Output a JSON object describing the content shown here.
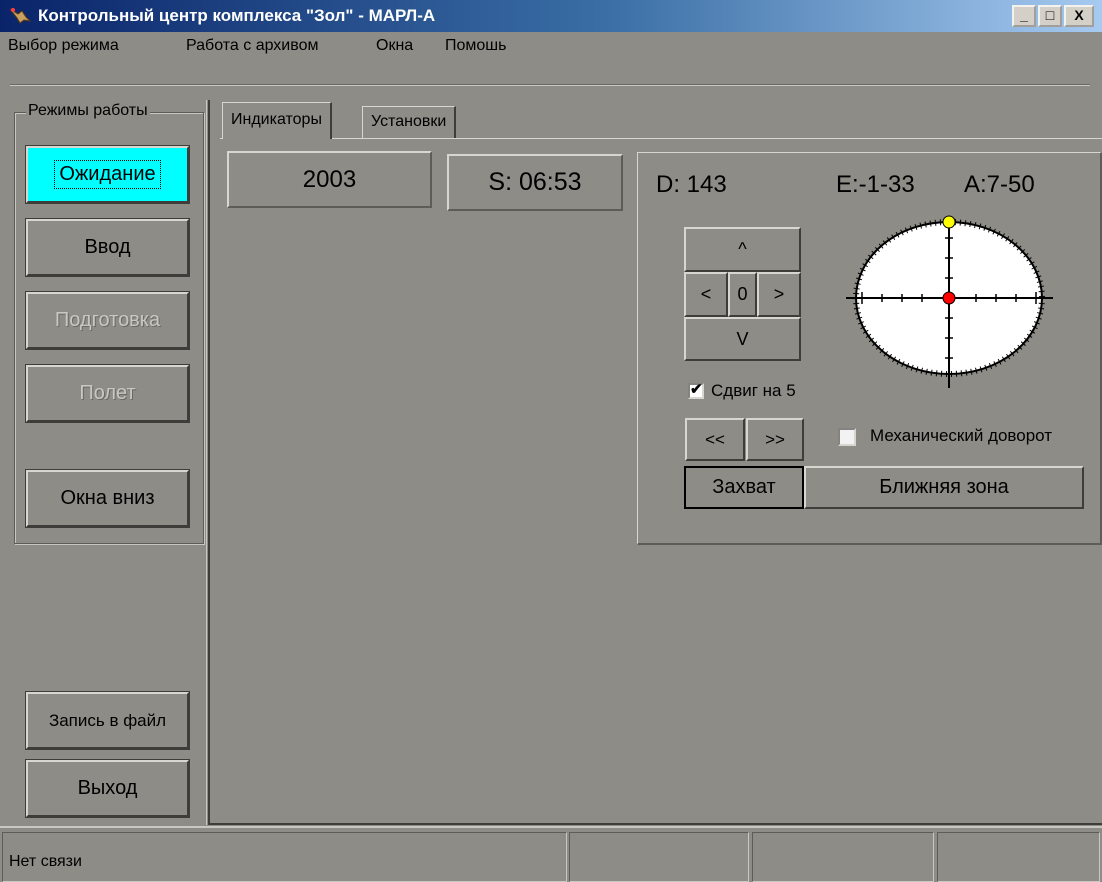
{
  "window": {
    "title": "Контрольный центр комплекса \"Зол\" - МАРЛ-А",
    "min": "_",
    "max": "□",
    "close": "X"
  },
  "menu": [
    "Выбор режима",
    "Работа с архивом",
    "Окна",
    "Помошь"
  ],
  "modes": {
    "legend": "Режимы работы",
    "wait": "Ожидание",
    "input": "Ввод",
    "prep": "Подготовка",
    "flight": "Полет",
    "windows_down": "Окна вниз",
    "write_file": "Запись в файл",
    "exit": "Выход"
  },
  "tabs": [
    "Индикаторы",
    "Установки"
  ],
  "indicators": {
    "year": "2003",
    "s": "S:  06:53"
  },
  "panel": {
    "d": "D: 143",
    "e": "E:-1-33",
    "a": "A:7-50",
    "up": "^",
    "left": "<",
    "zero": "0",
    "right": ">",
    "down": "V",
    "shift_label": "Сдвиг на 5",
    "shift_checked": true,
    "rew": "<<",
    "fwd": ">>",
    "mech_label": "Механический доворот",
    "mech_checked": false,
    "capture": "Захват",
    "near_zone": "Ближняя зона"
  },
  "status": {
    "connection": "Нет связи"
  },
  "colors": {
    "background": "#8e8c86",
    "active_button": "#00ffff",
    "target_yellow": "#ffff00",
    "center_red": "#ff0000"
  }
}
